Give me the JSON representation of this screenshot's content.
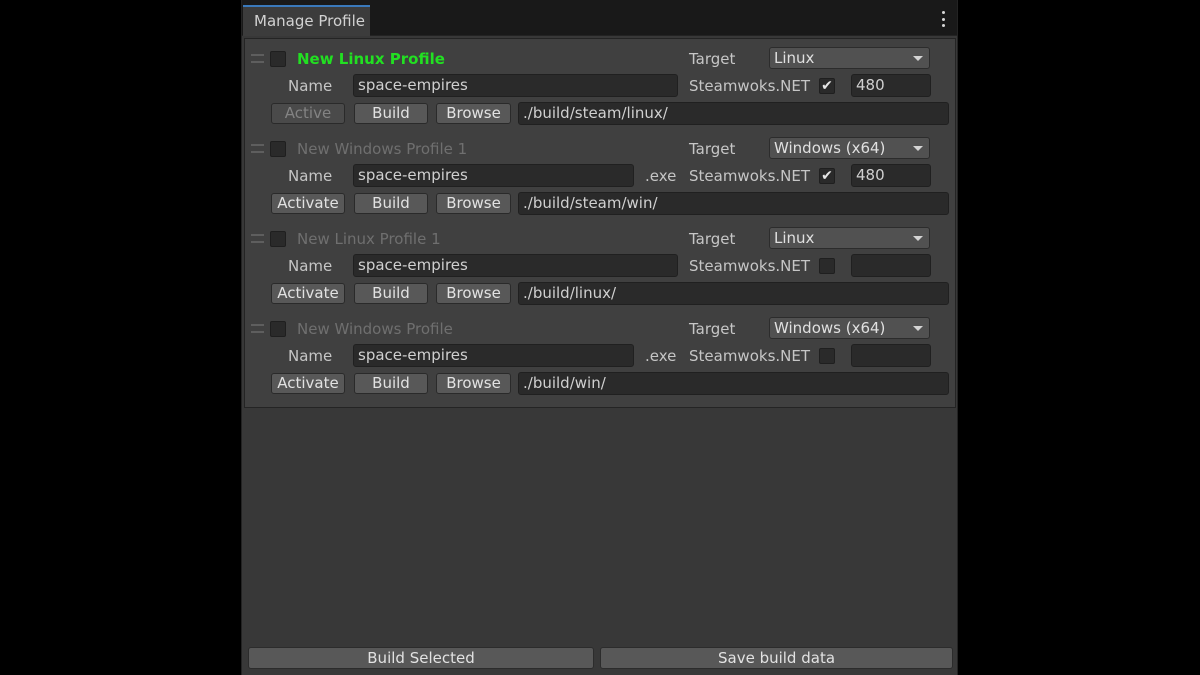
{
  "window": {
    "tab_title": "Manage Profile",
    "menu_icon": "kebab-menu-icon"
  },
  "labels": {
    "target": "Target",
    "name": "Name",
    "steamworks": "Steamwoks.NET",
    "build": "Build",
    "browse": "Browse",
    "exe_suffix": ".exe"
  },
  "profiles": [
    {
      "title": "New Linux Profile",
      "is_active": true,
      "selected": false,
      "target": "Linux",
      "name": "space-empires",
      "show_exe": false,
      "steamworks_enabled": true,
      "steam_checkmark": "✔",
      "app_id": "480",
      "action_label": "Active",
      "path": "./build/steam/linux/"
    },
    {
      "title": "New Windows Profile 1",
      "is_active": false,
      "selected": false,
      "target": "Windows (x64)",
      "name": "space-empires",
      "show_exe": true,
      "steamworks_enabled": true,
      "steam_checkmark": "✔",
      "app_id": "480",
      "action_label": "Activate",
      "path": "./build/steam/win/"
    },
    {
      "title": "New Linux Profile 1",
      "is_active": false,
      "selected": false,
      "target": "Linux",
      "name": "space-empires",
      "show_exe": false,
      "steamworks_enabled": false,
      "steam_checkmark": "",
      "app_id": "",
      "action_label": "Activate",
      "path": "./build/linux/"
    },
    {
      "title": "New Windows Profile",
      "is_active": false,
      "selected": false,
      "target": "Windows (x64)",
      "name": "space-empires",
      "show_exe": true,
      "steamworks_enabled": false,
      "steam_checkmark": "",
      "app_id": "",
      "action_label": "Activate",
      "path": "./build/win/"
    }
  ],
  "footer": {
    "build_selected": "Build Selected",
    "save_build_data": "Save build data"
  },
  "colors": {
    "active_title": "#22e022",
    "tab_accent": "#3a79bb"
  }
}
